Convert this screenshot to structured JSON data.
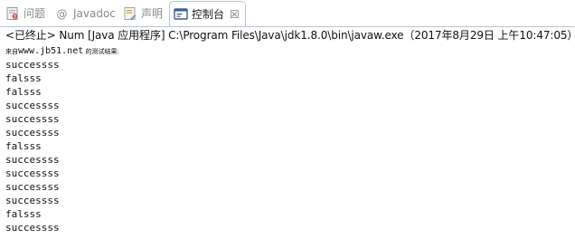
{
  "tabs": [
    {
      "label": "问题",
      "icon": "problems-icon",
      "active": false
    },
    {
      "label": "Javadoc",
      "icon": "javadoc-icon",
      "active": false
    },
    {
      "label": "声明",
      "icon": "declaration-icon",
      "active": false
    },
    {
      "label": "控制台",
      "icon": "console-icon",
      "active": true,
      "close": "☒"
    }
  ],
  "status": "<已终止> Num [Java 应用程序] C:\\Program Files\\Java\\jdk1.8.0\\bin\\javaw.exe（2017年8月29日 上午10:47:05）",
  "console": {
    "header_prefix": "来自",
    "header_url": "www.jb51.net",
    "header_suffix": " 的测试结果:",
    "lines": [
      "successss",
      "falsss",
      "falsss",
      "successss",
      "successss",
      "successss",
      "falsss",
      "successss",
      "successss",
      "successss",
      "successss",
      "falsss",
      "successss"
    ]
  },
  "colors": {
    "tab_border": "#b7c3d4",
    "inactive_text": "#8a8a8a",
    "console_text": "#111111"
  }
}
